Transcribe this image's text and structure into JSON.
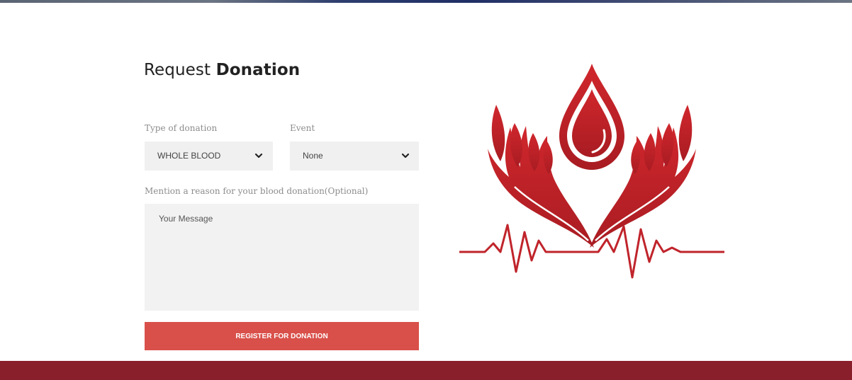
{
  "page": {
    "title_prefix": "Request",
    "title_bold": "Donation"
  },
  "form": {
    "type_label": "Type of donation",
    "type_value": "WHOLE BLOOD",
    "event_label": "Event",
    "event_value": "None",
    "reason_label": "Mention a reason for your blood donation(Optional)",
    "message_placeholder": "Your Message",
    "submit_label": "REGISTER FOR DONATION"
  },
  "logo": {
    "icon": "blood-drop-hands-heartbeat-icon"
  },
  "colors": {
    "accent": "#d9504a",
    "brand_dark": "#8a1f2c",
    "logo_red": "#c0242b",
    "field_bg": "#f0f0f0"
  }
}
